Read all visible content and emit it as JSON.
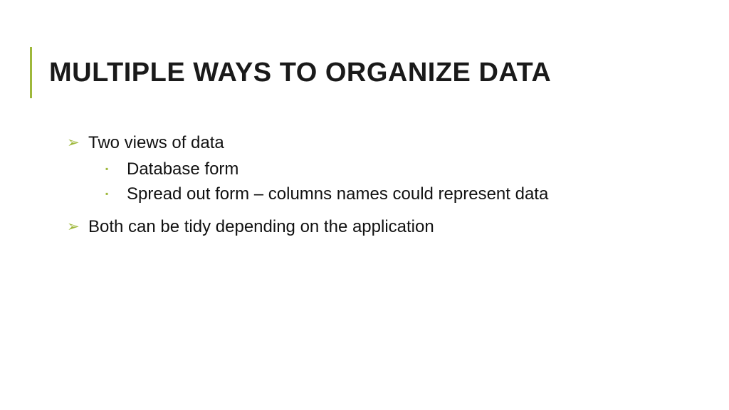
{
  "title": "MULTIPLE WAYS TO ORGANIZE DATA",
  "bullets": {
    "b1": "Two views of data",
    "b1a": "Database form",
    "b1b": "Spread out form – columns names could represent data",
    "b2": "Both can be tidy depending on the application"
  },
  "glyphs": {
    "arrow": "➢",
    "square": "▪"
  }
}
